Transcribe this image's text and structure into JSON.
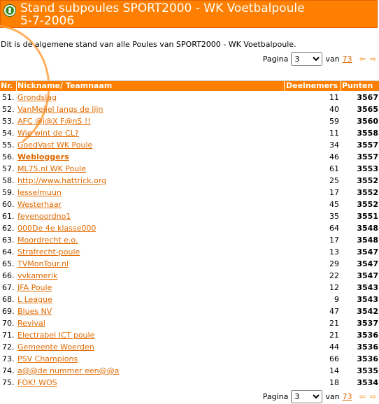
{
  "header": {
    "title_line1": "Stand subpoules SPORT2000 - WK Voetbalpoule",
    "title_line2": "5-7-2006"
  },
  "intro": "Dit is de algemene stand van alle Poules van SPORT2000 - WK Voetbalpoule.",
  "pager": {
    "label": "Pagina",
    "current_page": "3",
    "of_label": "van",
    "total_pages": "73"
  },
  "table": {
    "columns": [
      "Nr.",
      "Nickname/ Teamnaam",
      "Deelnemers",
      "Punten"
    ],
    "rows": [
      {
        "nr": "51.",
        "name": "Grondslag",
        "deelnemers": "11",
        "punten": "3567"
      },
      {
        "nr": "52.",
        "name": "VanMeijel langs de lijn",
        "deelnemers": "40",
        "punten": "3565"
      },
      {
        "nr": "53.",
        "name": "AFC @j@X F@nS !!",
        "deelnemers": "59",
        "punten": "3560"
      },
      {
        "nr": "54.",
        "name": "Wie wint de CL?",
        "deelnemers": "11",
        "punten": "3558"
      },
      {
        "nr": "55.",
        "name": "GoedVast WK Poule",
        "deelnemers": "34",
        "punten": "3557"
      },
      {
        "nr": "56.",
        "name": "Webloggers",
        "deelnemers": "46",
        "punten": "3557",
        "bold": true
      },
      {
        "nr": "57.",
        "name": "ML75.nl WK Poule",
        "deelnemers": "61",
        "punten": "3553"
      },
      {
        "nr": "58.",
        "name": "http://www.hattrick.org",
        "deelnemers": "25",
        "punten": "3552"
      },
      {
        "nr": "59.",
        "name": "Iesselmuun",
        "deelnemers": "17",
        "punten": "3552"
      },
      {
        "nr": "60.",
        "name": "Westerhaar",
        "deelnemers": "45",
        "punten": "3552"
      },
      {
        "nr": "61.",
        "name": "feyenoordno1",
        "deelnemers": "35",
        "punten": "3551"
      },
      {
        "nr": "62.",
        "name": "000De 4e klasse000",
        "deelnemers": "64",
        "punten": "3548"
      },
      {
        "nr": "63.",
        "name": "Moordrecht e.o.",
        "deelnemers": "17",
        "punten": "3548"
      },
      {
        "nr": "64.",
        "name": "Strafrecht-poule",
        "deelnemers": "13",
        "punten": "3547"
      },
      {
        "nr": "65.",
        "name": "TVMonTour.nl",
        "deelnemers": "29",
        "punten": "3547"
      },
      {
        "nr": "66.",
        "name": "vvkamerik",
        "deelnemers": "22",
        "punten": "3547"
      },
      {
        "nr": "67.",
        "name": "JFA Poule",
        "deelnemers": "12",
        "punten": "3543"
      },
      {
        "nr": "68.",
        "name": "L League",
        "deelnemers": "9",
        "punten": "3543"
      },
      {
        "nr": "69.",
        "name": "Blues NV",
        "deelnemers": "47",
        "punten": "3542"
      },
      {
        "nr": "70.",
        "name": "Revival",
        "deelnemers": "21",
        "punten": "3537"
      },
      {
        "nr": "71.",
        "name": "Electrabel ICT poule",
        "deelnemers": "21",
        "punten": "3536"
      },
      {
        "nr": "72.",
        "name": "Gemeente Woerden",
        "deelnemers": "44",
        "punten": "3536"
      },
      {
        "nr": "73.",
        "name": "PSV Champions",
        "deelnemers": "66",
        "punten": "3536"
      },
      {
        "nr": "74.",
        "name": "a@@de nummer een@@a",
        "deelnemers": "14",
        "punten": "3535"
      },
      {
        "nr": "75.",
        "name": "FOK! WOS",
        "deelnemers": "18",
        "punten": "3534"
      }
    ]
  },
  "icons": {
    "logo": "football-logo-icon",
    "prev": "arrow-left-icon",
    "next": "arrow-right-icon"
  },
  "colors": {
    "accent": "#ff8000",
    "link": "#e06a00"
  }
}
